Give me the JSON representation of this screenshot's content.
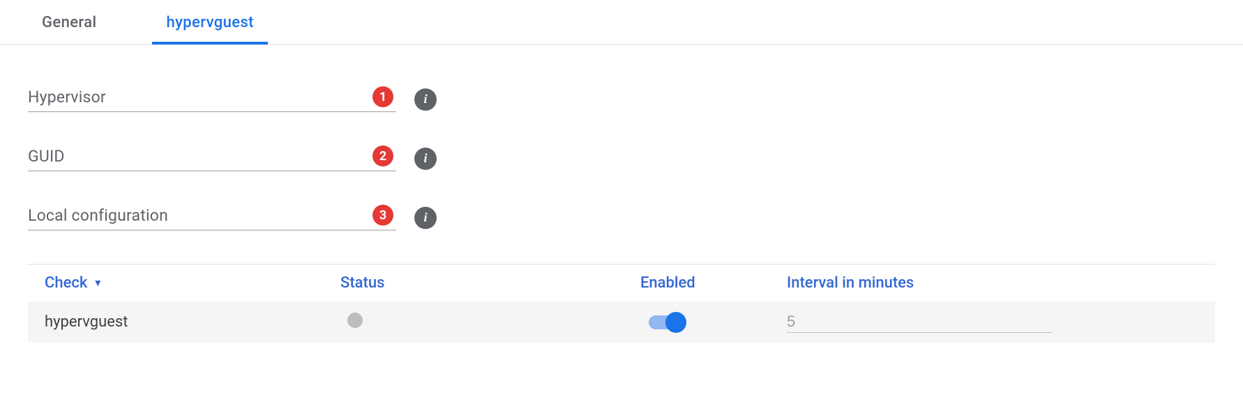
{
  "tabs": [
    {
      "label": "General",
      "active": false
    },
    {
      "label": "hypervguest",
      "active": true
    }
  ],
  "fields": [
    {
      "label": "Hypervisor",
      "annotation": "1"
    },
    {
      "label": "GUID",
      "annotation": "2"
    },
    {
      "label": "Local configuration",
      "annotation": "3"
    }
  ],
  "table": {
    "headers": {
      "check": "Check",
      "status": "Status",
      "enabled": "Enabled",
      "interval": "Interval in minutes"
    },
    "row": {
      "check": "hypervguest",
      "enabled": true,
      "interval": "5"
    }
  }
}
